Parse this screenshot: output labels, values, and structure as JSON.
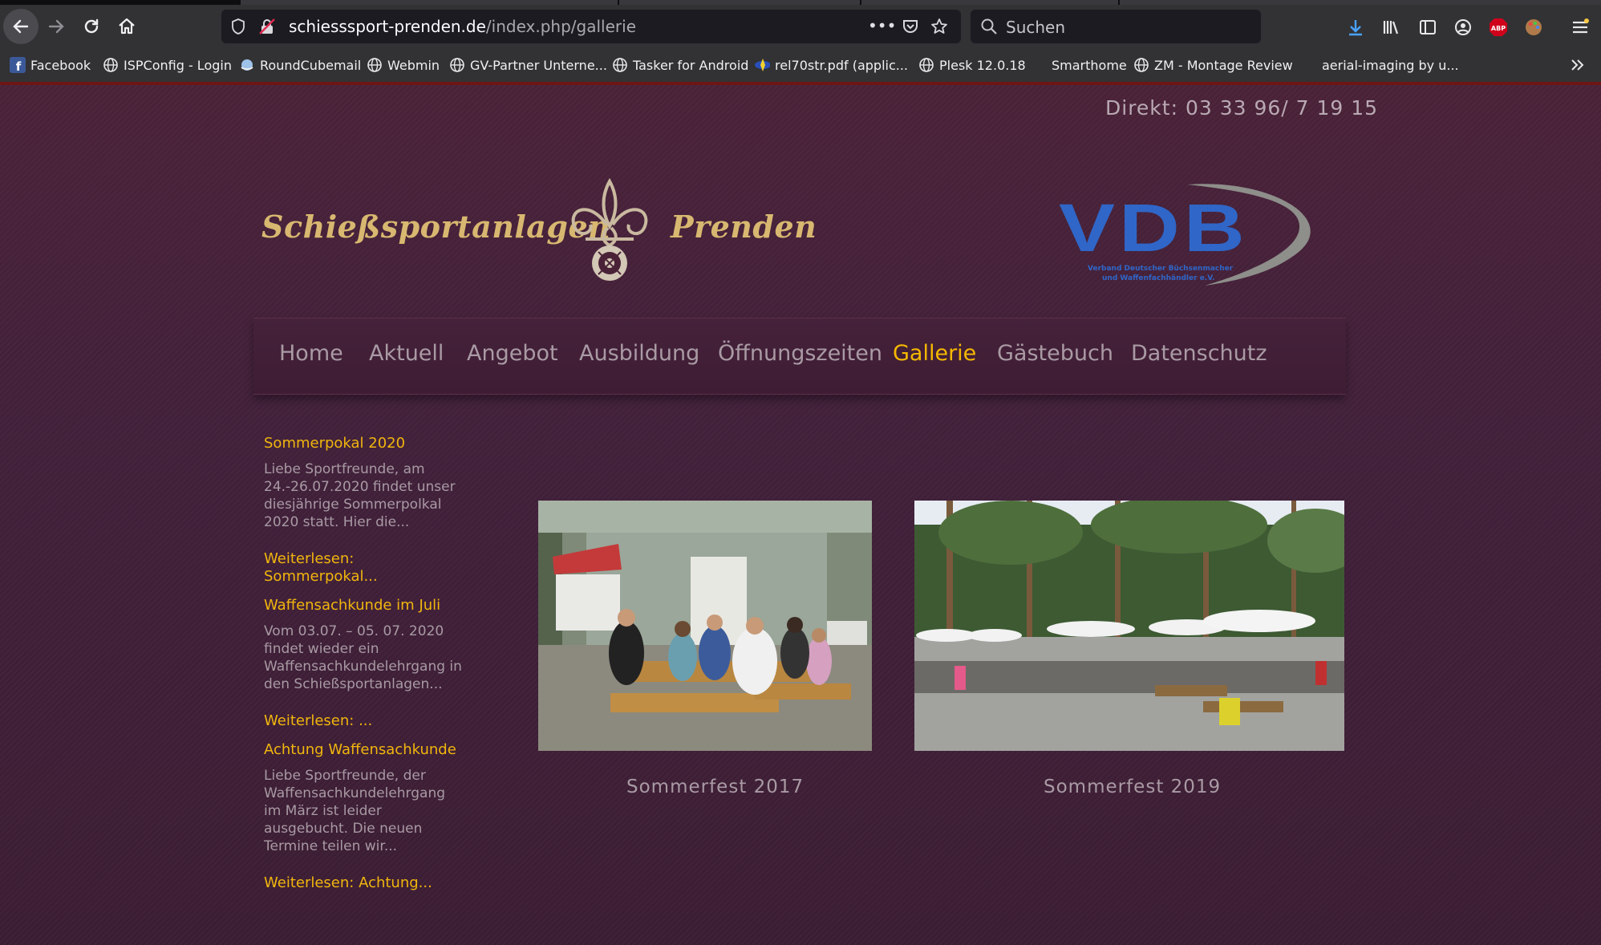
{
  "browser": {
    "url_domain": "schiesssport-prenden.de",
    "url_path": "/index.php/gallerie",
    "search_placeholder": "Suchen",
    "page_actions_label": "•••"
  },
  "bookmarks": [
    {
      "label": "Facebook",
      "icon": "facebook-icon"
    },
    {
      "label": "ISPConfig - Login",
      "icon": "globe-icon"
    },
    {
      "label": "RoundCubemail",
      "icon": "roundcube-icon"
    },
    {
      "label": "Webmin",
      "icon": "globe-icon"
    },
    {
      "label": "GV-Partner Unterne...",
      "icon": "globe-icon"
    },
    {
      "label": "Tasker for Android",
      "icon": "globe-icon"
    },
    {
      "label": "rel70str.pdf (applic...",
      "icon": "pdf-icon"
    },
    {
      "label": "Plesk 12.0.18",
      "icon": "globe-icon"
    },
    {
      "label": "Smarthome",
      "icon": ""
    },
    {
      "label": "ZM - Montage Review",
      "icon": "globe-icon"
    },
    {
      "label": "aerial-imaging by u...",
      "icon": ""
    }
  ],
  "header": {
    "phone": "Direkt: 03 33 96/ 7 19 15",
    "logo_left_word": "Schießsportanlagen",
    "logo_right_word": "Prenden",
    "vdb_letters": "VDB",
    "vdb_sub1": "Verband Deutscher Büchsenmacher",
    "vdb_sub2": "und Waffenfachhändler e.V."
  },
  "menu": [
    {
      "label": "Home",
      "active": false
    },
    {
      "label": "Aktuell",
      "active": false
    },
    {
      "label": "Angebot",
      "active": false
    },
    {
      "label": "Ausbildung",
      "active": false
    },
    {
      "label": "Öffnungszeiten",
      "active": false
    },
    {
      "label": "Gallerie",
      "active": true
    },
    {
      "label": "Gästebuch",
      "active": false
    },
    {
      "label": "Datenschutz",
      "active": false
    }
  ],
  "news": [
    {
      "title": "Sommerpokal 2020",
      "text": [
        "Liebe Sportfreunde, am",
        "24.-26.07.2020 findet unser",
        "diesjährige Sommerpolkal",
        "2020 statt. Hier die..."
      ],
      "more": [
        "Weiterlesen:",
        "Sommerpokal..."
      ]
    },
    {
      "title": "Waffensachkunde im Juli",
      "text": [
        "Vom 03.07. – 05. 07. 2020",
        "findet  wieder ein",
        "Waffensachkundelehrgang in",
        "den Schießsportanlagen..."
      ],
      "more": [
        "Weiterlesen: ..."
      ]
    },
    {
      "title": "Achtung Waffensachkunde",
      "text": [
        "Liebe Sportfreunde,   der",
        "Waffensachkundelehrgang",
        "im März ist leider",
        "ausgebucht. Die neuen",
        "Termine teilen wir..."
      ],
      "more": [
        "Weiterlesen: Achtung..."
      ]
    }
  ],
  "gallery": [
    {
      "caption": "Sommerfest  2017"
    },
    {
      "caption": "Sommerfest  2019"
    }
  ],
  "colors": {
    "page_bg": "#3e1c2f",
    "accent": "#f1b60d",
    "menu_text": "#a99aa4",
    "logo_gold": "#d8b870",
    "vdb_blue": "#2f66c8"
  }
}
